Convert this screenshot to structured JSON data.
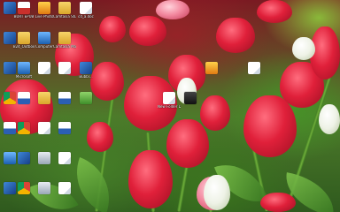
{
  "desktop": {
    "icons": [
      {
        "label": "",
        "glyph": "app-icon"
      },
      {
        "label": "BURT EPUB",
        "glyph": "red-app-icon"
      },
      {
        "label": "Live Photo",
        "glyph": "orange-app-icon"
      },
      {
        "label": "Camtasia Studio",
        "glyph": "folder-icon"
      },
      {
        "label": "cd_a.doc",
        "glyph": "document-icon"
      },
      {
        "label": "",
        "glyph": "app-icon"
      },
      {
        "label": "B24_Outbox",
        "glyph": "folder-icon"
      },
      {
        "label": "Computer",
        "glyph": "monitor-icon"
      },
      {
        "label": "Camtasia Mars video",
        "glyph": "folder-icon"
      },
      {
        "label": "",
        "glyph": "app-icon"
      },
      {
        "label": "Microsoft",
        "glyph": "monitor-icon"
      },
      {
        "label": "",
        "glyph": "document-icon"
      },
      {
        "label": "",
        "glyph": "document-icon"
      },
      {
        "label": "Bubbl...",
        "glyph": "app-icon"
      },
      {
        "label": "",
        "glyph": "chrome-icon"
      },
      {
        "label": "",
        "glyph": "word-icon"
      },
      {
        "label": "",
        "glyph": "folder-icon"
      },
      {
        "label": "",
        "glyph": "word-icon"
      },
      {
        "label": "",
        "glyph": "green-app-icon"
      },
      {
        "label": "",
        "glyph": "word-icon"
      },
      {
        "label": "",
        "glyph": "chrome-icon"
      },
      {
        "label": "",
        "glyph": "document-icon"
      },
      {
        "label": "",
        "glyph": "word-icon"
      },
      {
        "label": "",
        "glyph": "shield-icon"
      },
      {
        "label": "",
        "glyph": "chrome-icon"
      },
      {
        "label": "",
        "glyph": "document-icon"
      },
      {
        "label": "",
        "glyph": "monitor-icon"
      },
      {
        "label": "",
        "glyph": "app-icon"
      },
      {
        "label": "",
        "glyph": "document-icon"
      },
      {
        "label": "",
        "glyph": "app-icon"
      },
      {
        "label": "",
        "glyph": "chrome-icon"
      },
      {
        "label": "",
        "glyph": "shield-icon"
      },
      {
        "label": "",
        "glyph": "document-icon"
      },
      {
        "label": "New Folder Documents",
        "glyph": "document-icon"
      },
      {
        "label": "",
        "glyph": "dark-app-icon"
      },
      {
        "label": "",
        "glyph": "orange-app-icon"
      },
      {
        "label": "",
        "glyph": "document-icon"
      }
    ]
  },
  "colors": {
    "label_text": "#ffffff",
    "accent_tulip": "#e0203a"
  }
}
